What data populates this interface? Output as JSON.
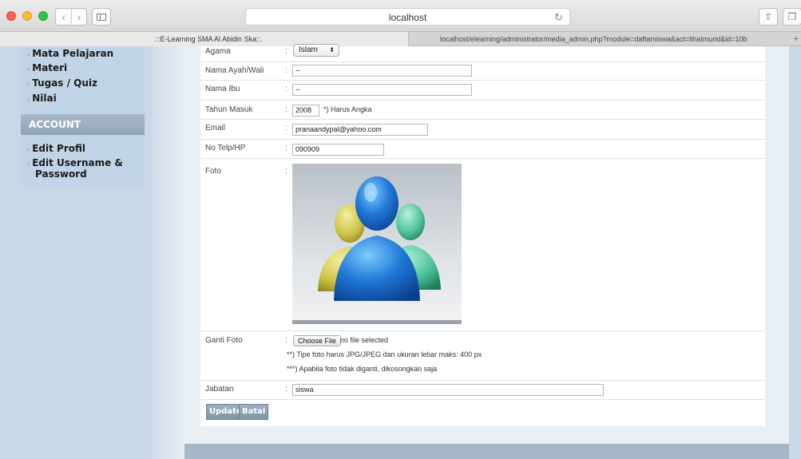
{
  "browser": {
    "url_display": "localhost",
    "tabs": [
      {
        "title": ".::E-Learning SMA Al Abidin Ska::."
      },
      {
        "title": "localhost/elearning/administrator/media_admin.php?module=daftarsiswa&act=lihatmurid&id=10b"
      }
    ],
    "icons": {
      "back": "chevron-left-icon",
      "forward": "chevron-right-icon",
      "sidebar": "sidebar-icon",
      "reload": "reload-icon",
      "share": "share-icon",
      "tabs": "tabs-icon",
      "new_tab": "plus-icon"
    },
    "glyphs": {
      "back": "‹",
      "forward": "›",
      "reload": "↻",
      "share": "⇧",
      "tabs": "❐",
      "new_tab": "+",
      "nav_arrow": "›",
      "select_chev": "⬍"
    }
  },
  "sidebar": {
    "menu": [
      {
        "label": "Mata Pelajaran"
      },
      {
        "label": "Materi"
      },
      {
        "label": "Tugas / Quiz"
      },
      {
        "label": "Nilai"
      }
    ],
    "account_header": "ACCOUNT",
    "account_items": [
      {
        "label": "Edit Profil"
      },
      {
        "label": "Edit Username & Password"
      }
    ]
  },
  "form": {
    "colon": ":",
    "agama": {
      "label": "Agama",
      "value": "Islam"
    },
    "ayah": {
      "label": "Nama Ayah/Wali",
      "value": "--"
    },
    "ibu": {
      "label": "Nama Ibu",
      "value": "--"
    },
    "tahun": {
      "label": "Tahun Masuk",
      "value": "2008",
      "hint": "*) Harus Angka"
    },
    "email": {
      "label": "Email",
      "value": "pranaandypal@yahoo.com"
    },
    "telp": {
      "label": "No Telp/HP",
      "value": "090909"
    },
    "foto": {
      "label": "Foto"
    },
    "ganti_foto": {
      "label": "Ganti Foto",
      "button": "Choose File",
      "status": "no file selected",
      "note1": "**) Tipe foto harus JPG/JPEG dan ukuran lebar maks: 400 px",
      "note2": "***) Apabila foto tidak diganti, dikosongkan saja"
    },
    "jabatan": {
      "label": "Jabatan",
      "value": "siswa"
    },
    "update_button": "Update",
    "batal_button": "Batal"
  },
  "colors": {
    "page_bg": "#c9d8e7",
    "account_header": "#9aadc0",
    "button": "#8fa2b6"
  }
}
